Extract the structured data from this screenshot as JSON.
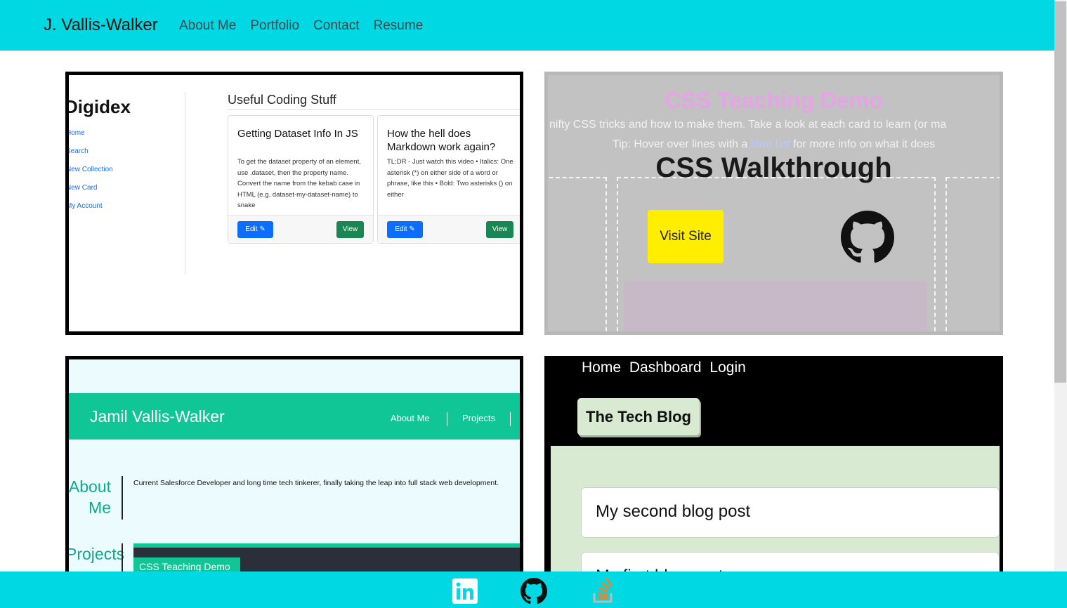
{
  "navbar": {
    "brand": "J. Vallis-Walker",
    "links": [
      "About Me",
      "Portfolio",
      "Contact",
      "Resume"
    ]
  },
  "projects": {
    "digidex": {
      "app_title": "Digidex",
      "nav": [
        "Home",
        "Search",
        "New Collection",
        "New Card",
        "My Account"
      ],
      "section": "Useful Coding Stuff",
      "cards": [
        {
          "title": "Getting Dataset Info In JS",
          "body": "To get the dataset property of an element, use .dataset, then the property name. Convert the name from the kebab case in HTML (e.g. dataset-my-dataset-name) to snake",
          "edit": "Edit",
          "view": "View"
        },
        {
          "title": "How the hell does Markdown work again?",
          "body": "TL;DR - Just watch this video • Italics: One asterisk (*) on either side of a word or phrase, like this • Bold: Two asterisks () on either",
          "edit": "Edit",
          "view": "View"
        }
      ]
    },
    "css_demo": {
      "title": "CSS Teaching Demo",
      "subtitle": "nifty CSS tricks and how to make them. Take a look at each card to learn (or ma",
      "tip_prefix": "Tip: Hover over lines with a ",
      "tip_tint": "blue tint",
      "tip_suffix": " for more info on what it does",
      "overlay_title": "CSS Walkthrough",
      "visit_button": "Visit Site"
    },
    "portfolio": {
      "name": "Jamil Vallis-Walker",
      "links": [
        "About Me",
        "Projects"
      ],
      "about_heading": "About Me",
      "about_text": "Current Salesforce Developer and long time tech tinkerer, finally taking the leap into full stack web development.",
      "projects_heading": "Projects",
      "thumb_label": "CSS Teaching Demo"
    },
    "blog": {
      "nav": "Home Dashboard Login",
      "brand": "The Tech Blog",
      "posts": [
        "My second blog post",
        "My first blog post"
      ]
    }
  },
  "footer": {
    "icons": [
      "linkedin-icon",
      "github-icon",
      "stackoverflow-icon"
    ]
  },
  "colors": {
    "accent": "#00d9e3",
    "visit_button": "#ffee00",
    "portfolio_green": "#10c596",
    "blog_green": "#d9ead3"
  }
}
